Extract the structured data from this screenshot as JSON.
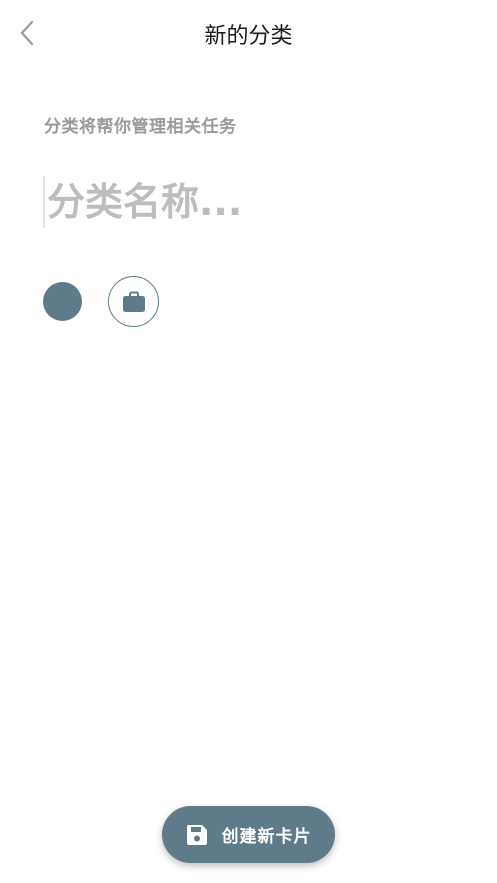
{
  "header": {
    "title": "新的分类",
    "back_icon": "chevron-left-icon"
  },
  "form": {
    "helper_text": "分类将帮你管理相关任务",
    "name_placeholder": "分类名称...",
    "name_value": ""
  },
  "appearance": {
    "selected_color": "#5f7b8a",
    "selected_icon": "briefcase-icon"
  },
  "footer": {
    "create_label": "创建新卡片",
    "create_icon": "save-icon"
  },
  "colors": {
    "accent": "#5f7b8a",
    "text_primary": "#1a1a1a",
    "text_secondary": "#9a9a9a",
    "placeholder": "#bdbdbd"
  }
}
